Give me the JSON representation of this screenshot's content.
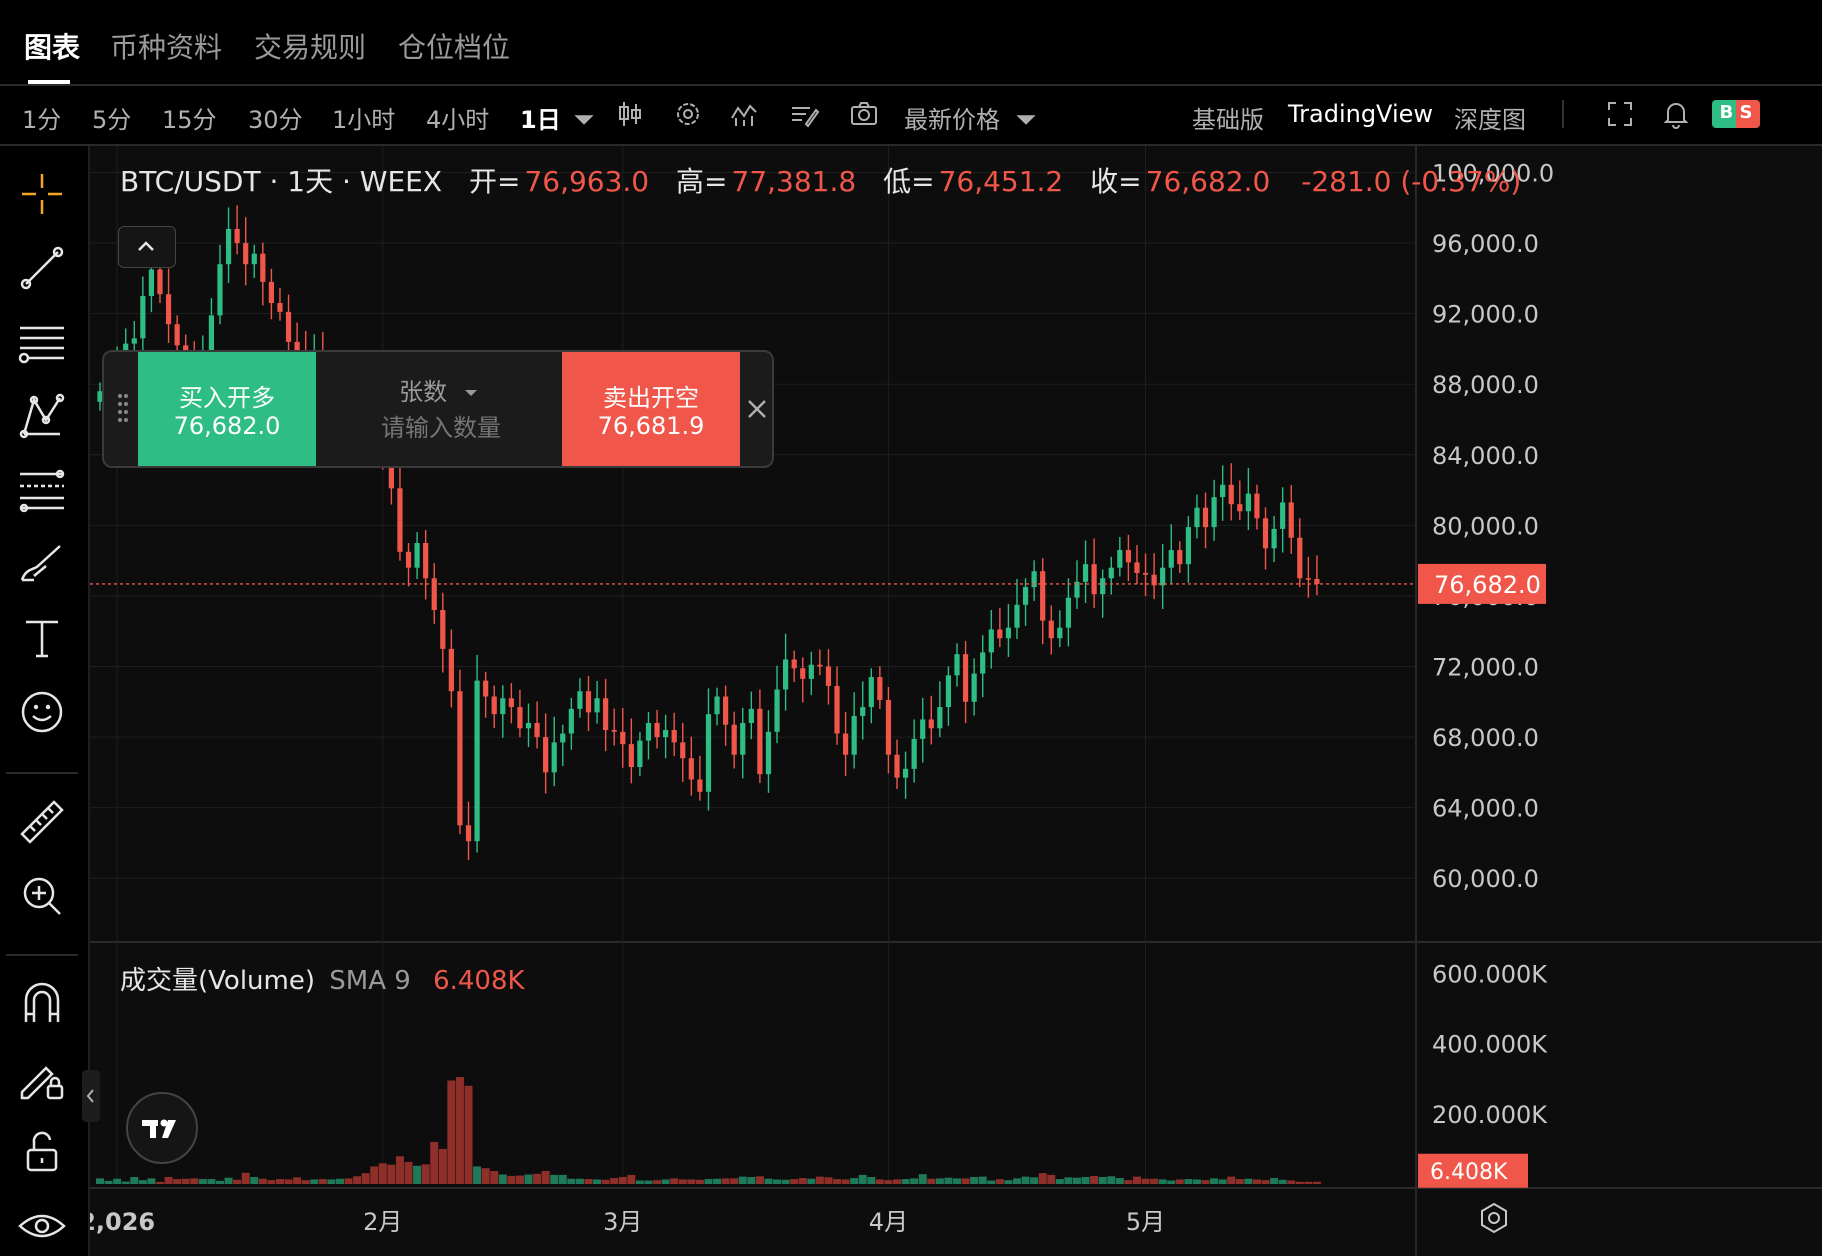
{
  "top_tabs": [
    "图表",
    "币种资料",
    "交易规则",
    "仓位档位"
  ],
  "toolbar": {
    "intervals": [
      "1分",
      "5分",
      "15分",
      "30分",
      "1小时",
      "4小时",
      "1日"
    ],
    "active_interval": "1日",
    "price_type": "最新价格",
    "views": [
      "基础版",
      "TradingView",
      "深度图"
    ],
    "active_view": "TradingView",
    "bs_badge": "B S"
  },
  "legend": {
    "symbol": "BTC/USDT · 1天 · WEEX",
    "open_label": "开=",
    "open": "76,963.0",
    "high_label": "高=",
    "high": "77,381.8",
    "low_label": "低=",
    "low": "76,451.2",
    "close_label": "收=",
    "close": "76,682.0",
    "change": "-281.0 (-0.37%)"
  },
  "order_panel": {
    "buy_label": "买入开多",
    "buy_price": "76,682.0",
    "sell_label": "卖出开空",
    "sell_price": "76,681.9",
    "unit": "张数",
    "qty_placeholder": "请输入数量"
  },
  "volume_legend": {
    "title": "成交量(Volume)",
    "sma": "SMA 9",
    "value": "6.408K"
  },
  "colors": {
    "up": "#2ebd85",
    "down": "#f0574a",
    "up_volume": "#1f7a5a",
    "down_volume": "#8f2f2a"
  },
  "chart_data": {
    "type": "candlestick",
    "price_axis": {
      "ticks": [
        "100,000.0",
        "96,000.0",
        "92,000.0",
        "88,000.0",
        "84,000.0",
        "80,000.0",
        "76,000.0",
        "72,000.0",
        "68,000.0",
        "64,000.0",
        "60,000.0"
      ],
      "ylim": [
        56500,
        101500
      ]
    },
    "last_price_label": "76,682.0",
    "last_price": 76682,
    "volume_axis": {
      "ticks": [
        "600.000K",
        "400.000K",
        "200.000K"
      ],
      "ylim": [
        0,
        650000
      ]
    },
    "last_volume_label": "6.408K",
    "time_axis": [
      {
        "label": "2,026",
        "index": 2
      },
      {
        "label": "2月",
        "index": 33
      },
      {
        "label": "3月",
        "index": 61
      },
      {
        "label": "4月",
        "index": 92
      },
      {
        "label": "5月",
        "index": 122
      }
    ],
    "closes": [
      87600,
      88700,
      89400,
      90300,
      90600,
      93000,
      94500,
      93100,
      91400,
      90200,
      89700,
      89300,
      89900,
      91900,
      94800,
      96800,
      96000,
      94800,
      95400,
      93800,
      92600,
      92100,
      90400,
      89800,
      89300,
      89500,
      88100,
      88400,
      89000,
      88400,
      87400,
      86700,
      85600,
      84500,
      82100,
      78500,
      77600,
      79000,
      77000,
      75200,
      73000,
      70600,
      63000,
      62100,
      71200,
      70300,
      69300,
      70200,
      69700,
      68500,
      68800,
      68000,
      66000,
      67700,
      68200,
      69600,
      70600,
      69400,
      70200,
      68400,
      68300,
      67600,
      66300,
      67800,
      68800,
      68000,
      68400,
      67700,
      66800,
      65600,
      64900,
      69300,
      70300,
      68700,
      67000,
      68800,
      69600,
      65900,
      68300,
      70700,
      72400,
      71900,
      71300,
      72100,
      72000,
      70900,
      68200,
      67000,
      69200,
      69700,
      71400,
      70100,
      67000,
      65700,
      66200,
      67900,
      69000,
      68500,
      69700,
      71500,
      72700,
      70000,
      71600,
      72800,
      74100,
      73600,
      74200,
      75500,
      76500,
      77400,
      74600,
      73600,
      74200,
      75900,
      76800,
      77800,
      76100,
      77000,
      77600,
      78600,
      77900,
      77300,
      77200,
      76600,
      77600,
      78600,
      77800,
      79900,
      81000,
      79900,
      81600,
      82300,
      81200,
      80800,
      81800,
      80400,
      78700,
      79800,
      81300,
      79300,
      77000,
      76963,
      76682
    ],
    "volumes": [
      16000,
      9000,
      15000,
      7000,
      20000,
      11000,
      16000,
      6000,
      20000,
      14000,
      15000,
      16000,
      14000,
      14000,
      9000,
      18000,
      12000,
      32000,
      20000,
      15000,
      11000,
      14000,
      13000,
      19000,
      11000,
      13000,
      14000,
      13000,
      15000,
      16000,
      22000,
      31000,
      50000,
      59000,
      55000,
      79000,
      63000,
      52000,
      56000,
      120000,
      100000,
      295000,
      305000,
      280000,
      50000,
      45000,
      37000,
      27000,
      23000,
      24000,
      27000,
      29000,
      37000,
      26000,
      26000,
      15000,
      15000,
      14000,
      13000,
      12000,
      17000,
      20000,
      26000,
      10000,
      10000,
      11000,
      13000,
      16000,
      13000,
      13000,
      12000,
      14000,
      15000,
      16000,
      16000,
      21000,
      20000,
      22000,
      15000,
      13000,
      12000,
      14000,
      17000,
      15000,
      21000,
      19000,
      14000,
      13000,
      17000,
      26000,
      20000,
      13000,
      11000,
      13000,
      14000,
      16000,
      28000,
      15000,
      16000,
      18000,
      16000,
      16000,
      20000,
      21000,
      10000,
      14000,
      11000,
      16000,
      21000,
      19000,
      31000,
      26000,
      14000,
      19000,
      18000,
      20000,
      23000,
      20000,
      22000,
      17000,
      11000,
      21000,
      15000,
      15000,
      13000,
      10000,
      13000,
      14000,
      13000,
      11000,
      16000,
      13000,
      21000,
      14000,
      15000,
      13000,
      11000,
      17000,
      12000,
      10000,
      6408,
      6408,
      6408
    ]
  }
}
